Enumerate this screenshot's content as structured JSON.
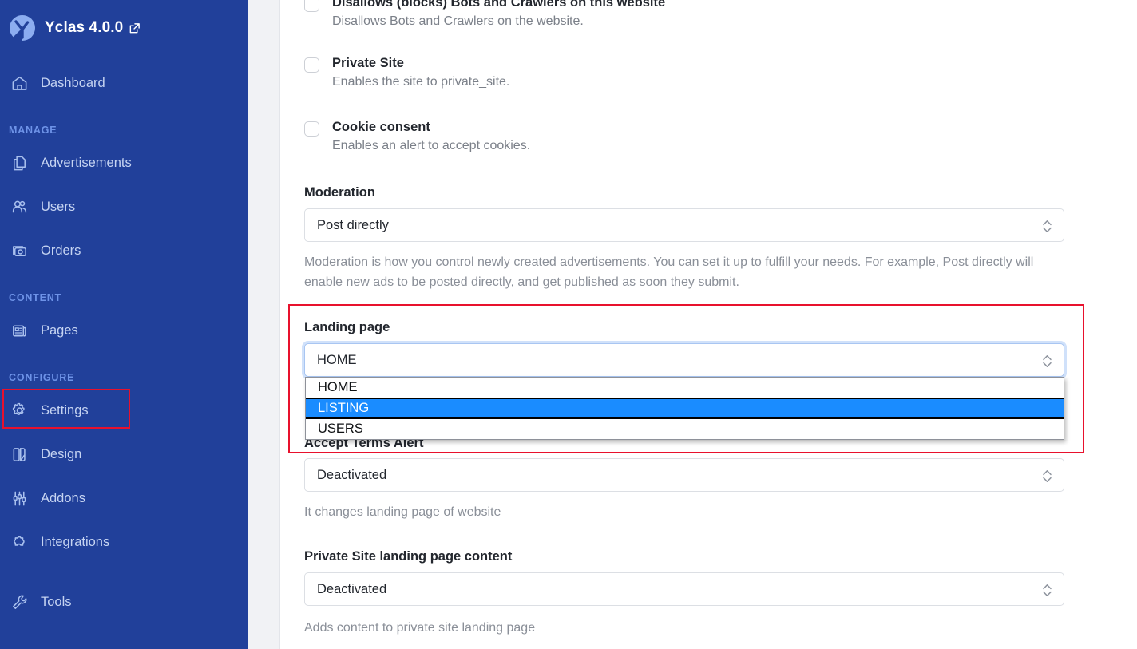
{
  "sidebar": {
    "brand": {
      "name": "Yclas 4.0.0",
      "icon": "external-link-icon"
    },
    "dashboard": {
      "label": "Dashboard",
      "icon": "home-icon"
    },
    "sections": [
      {
        "label": "MANAGE",
        "items": [
          {
            "label": "Advertisements",
            "icon": "copy-icon"
          },
          {
            "label": "Users",
            "icon": "users-icon"
          },
          {
            "label": "Orders",
            "icon": "orders-icon"
          }
        ]
      },
      {
        "label": "CONTENT",
        "items": [
          {
            "label": "Pages",
            "icon": "pages-icon"
          }
        ]
      },
      {
        "label": "CONFIGURE",
        "items": [
          {
            "label": "Settings",
            "icon": "gear-icon"
          },
          {
            "label": "Design",
            "icon": "design-icon"
          },
          {
            "label": "Addons",
            "icon": "sliders-icon"
          },
          {
            "label": "Integrations",
            "icon": "puzzle-icon"
          },
          {
            "label": "Tools",
            "icon": "wrench-icon"
          }
        ]
      }
    ],
    "highlighted_item": "Settings"
  },
  "main": {
    "checkboxes": [
      {
        "title": "Disallows (blocks) Bots and Crawlers on this website",
        "desc": "Disallows Bots and Crawlers on the website.",
        "checked": false
      },
      {
        "title": "Private Site",
        "desc": "Enables the site to private_site.",
        "checked": false
      },
      {
        "title": "Cookie consent",
        "desc": "Enables an alert to accept cookies.",
        "checked": false
      }
    ],
    "moderation": {
      "label": "Moderation",
      "value": "Post directly",
      "help": "Moderation is how you control newly created advertisements. You can set it up to fulfill your needs. For example, Post directly will enable new ads to be posted directly, and get published as soon they submit."
    },
    "landing_page": {
      "label": "Landing page",
      "value": "HOME",
      "options": [
        "HOME",
        "LISTING",
        "USERS"
      ],
      "highlighted_option": "LISTING",
      "open": true
    },
    "accept_terms": {
      "label": "Accept Terms Alert",
      "value": "Deactivated",
      "help": "It changes landing page of website"
    },
    "private_site_content": {
      "label": "Private Site landing page content",
      "value": "Deactivated",
      "help": "Adds content to private site landing page"
    }
  },
  "colors": {
    "sidebar_bg": "#21409a",
    "annotation": "#e8112d",
    "option_highlight": "#1a8cff",
    "accent_text": "#6e93e8"
  }
}
